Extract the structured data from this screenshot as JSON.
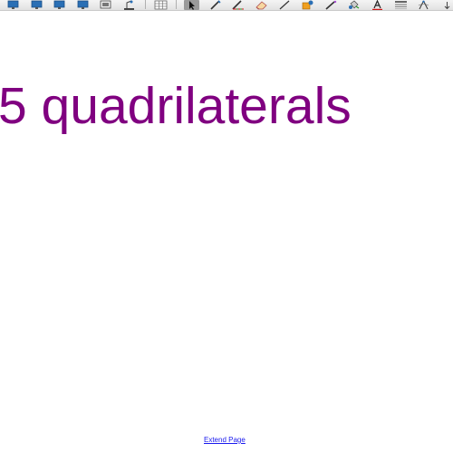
{
  "toolbar": {
    "tools": [
      "monitor-icon",
      "monitor-icon",
      "monitor-icon",
      "monitor-icon",
      "screen-capture-icon",
      "document-camera-icon",
      "table-icon",
      "select-arrow-icon",
      "pen-icon",
      "creative-pen-icon",
      "eraser-icon",
      "line-icon",
      "shapes-icon",
      "magic-pen-icon",
      "fill-icon",
      "text-icon",
      "properties-icon",
      "compass-icon",
      "move-toolbar-icon"
    ],
    "accent_colors": {
      "monitor": "#2a6fb5",
      "text_tool": "#d01818",
      "shapes": "#f0a020"
    }
  },
  "canvas": {
    "heading": "5 quadrilaterals",
    "heading_color": "#800080",
    "extend_page_label": "Extend Page"
  }
}
